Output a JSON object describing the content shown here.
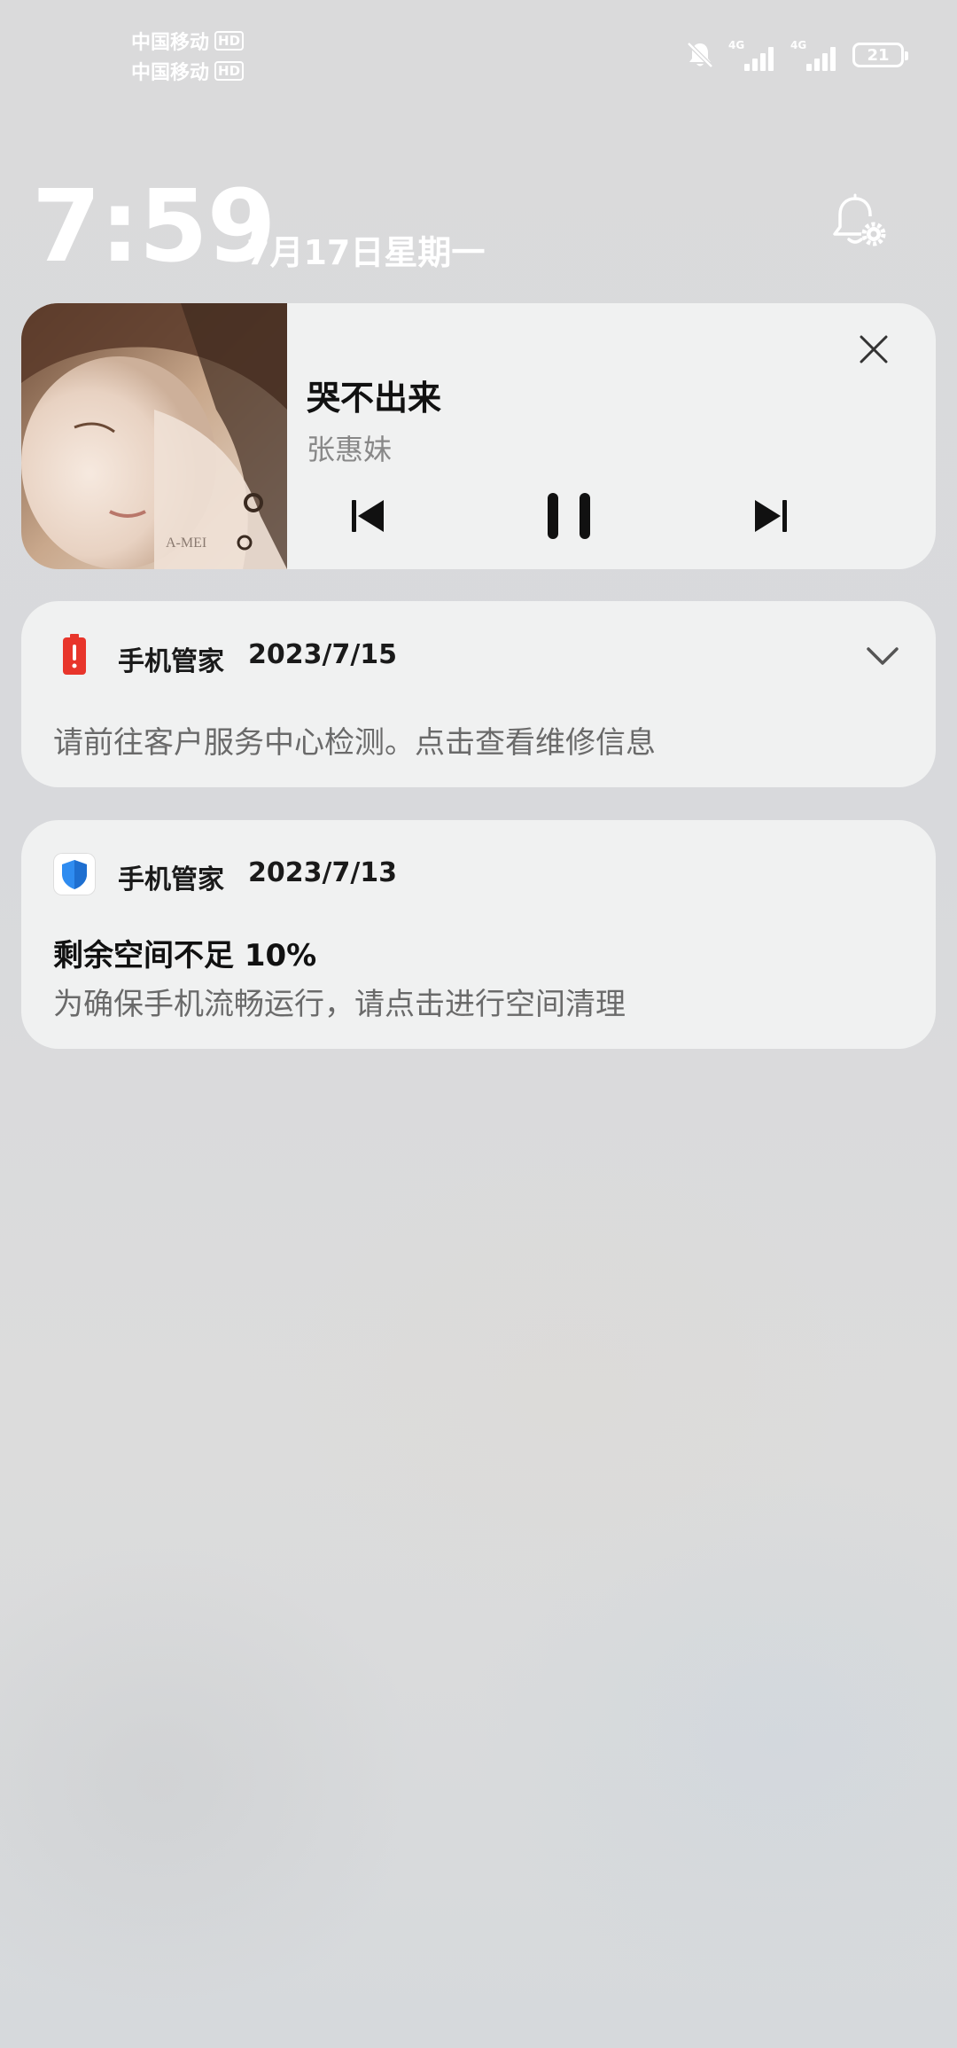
{
  "status_bar": {
    "carrier1": "中国移动",
    "carrier2": "中国移动",
    "hd": "HD",
    "network1": "4G",
    "network2": "4G",
    "battery": "21",
    "icons": [
      "bell-muted-icon",
      "signal-icon",
      "battery-icon"
    ]
  },
  "lockscreen": {
    "time": "7:59",
    "date": "7月17日星期一",
    "settings_icon": "bell-gear-icon"
  },
  "music": {
    "title": "哭不出来",
    "artist": "张惠妹",
    "album_text": "A-MEI",
    "controls": [
      "prev-icon",
      "pause-icon",
      "next-icon"
    ],
    "close_icon": "close-icon"
  },
  "notifications": [
    {
      "app": "手机管家",
      "date": "2023/7/15",
      "title": "",
      "body": "请前往客户服务中心检测。点击查看维修信息",
      "icon": "battery-alert-icon",
      "icon_color": "#e8352b"
    },
    {
      "app": "手机管家",
      "date": "2023/7/13",
      "title": "剩余空间不足 10%",
      "body": "为确保手机流畅运行，请点击进行空间清理",
      "icon": "shield-icon",
      "icon_color": "#2f8cf0"
    }
  ]
}
